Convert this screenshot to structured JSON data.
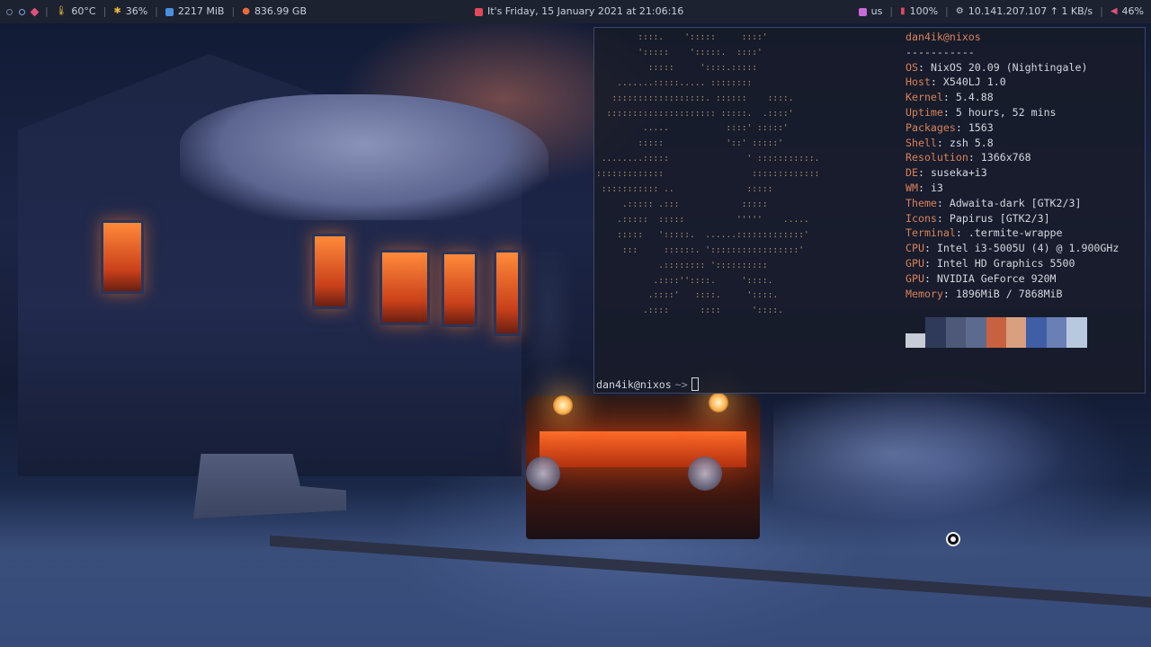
{
  "topbar": {
    "workspaces": [
      {
        "state": "empty"
      },
      {
        "state": "occupied"
      },
      {
        "state": "active"
      }
    ],
    "temperature": "60°C",
    "cpu": "36%",
    "memory": "2217 MiB",
    "disk": "836.99 GB",
    "datetime": "It's Friday, 15 January 2021 at 21:06:16",
    "keyboard_layout": "us",
    "battery": "100%",
    "network": "10.141.207.107 ↑ 1 KB/s",
    "volume": "46%",
    "icons": {
      "temperature": "thermometer-icon",
      "cpu": "cpu-icon",
      "memory": "memory-icon",
      "disk": "disk-icon",
      "calendar": "calendar-icon",
      "keyboard": "keyboard-icon",
      "battery": "battery-icon",
      "network": "network-icon",
      "volume": "volume-icon"
    },
    "colors": {
      "bar_bg": "#1d2230",
      "active_workspace": "#e0507a",
      "temperature": "#e5b73d",
      "memory": "#4a8fe0",
      "disk": "#e86b3a"
    }
  },
  "terminal": {
    "ascii_art": "        ::::.    ':::::     ::::'\n        ':::::    ':::::.  ::::'\n          :::::     '::::.:::::\n    .......:::::..... ::::::::\n   ::::::::::::::::::. ::::::    ::::.\n  ::::::::::::::::::::: :::::.  .::::'\n         .....           ::::' :::::'\n        :::::            '::' :::::'\n ........:::::               ' :::::::::::.\n:::::::::::::                 :::::::::::::\n ::::::::::: ..              :::::\n     .::::: .:::            :::::\n    .:::::  :::::          '''''    .....\n    :::::   ':::::.  ......:::::::::::::'\n     :::     ::::::. ':::::::::::::::::'\n            .:::::::: '::::::::::\n           .::::''::::.     '::::.\n          .::::'   ::::.     '::::.\n         .::::      ::::      '::::.",
    "user_host": "dan4ik@nixos",
    "dashes": "-----------",
    "info": [
      {
        "key": "OS",
        "value": "NixOS 20.09 (Nightingale)"
      },
      {
        "key": "Host",
        "value": "X540LJ 1.0"
      },
      {
        "key": "Kernel",
        "value": "5.4.88"
      },
      {
        "key": "Uptime",
        "value": "5 hours, 52 mins"
      },
      {
        "key": "Packages",
        "value": "1563"
      },
      {
        "key": "Shell",
        "value": "zsh 5.8"
      },
      {
        "key": "Resolution",
        "value": "1366x768"
      },
      {
        "key": "DE",
        "value": "suseka+i3"
      },
      {
        "key": "WM",
        "value": "i3"
      },
      {
        "key": "Theme",
        "value": "Adwaita-dark [GTK2/3]"
      },
      {
        "key": "Icons",
        "value": "Papirus [GTK2/3]"
      },
      {
        "key": "Terminal",
        "value": ".termite-wrappe"
      },
      {
        "key": "CPU",
        "value": "Intel i3-5005U (4) @ 1.900GHz"
      },
      {
        "key": "GPU",
        "value": "Intel HD Graphics 5500"
      },
      {
        "key": "GPU",
        "value": "NVIDIA GeForce 920M"
      },
      {
        "key": "Memory",
        "value": "1896MiB / 7868MiB"
      }
    ],
    "palette": [
      "#c8ccd6",
      "#2f3a5a",
      "#4e5878",
      "#5b6a8e",
      "#c8613f",
      "#d8a07e",
      "#3f5ea6",
      "#6a7fb6",
      "#b8c8de"
    ],
    "prompt_user": "dan4ik@nixos",
    "prompt_symbol": "~>",
    "colors": {
      "accent": "#d9825a",
      "ascii": "#d9b27d",
      "text": "#d4d7de"
    }
  }
}
